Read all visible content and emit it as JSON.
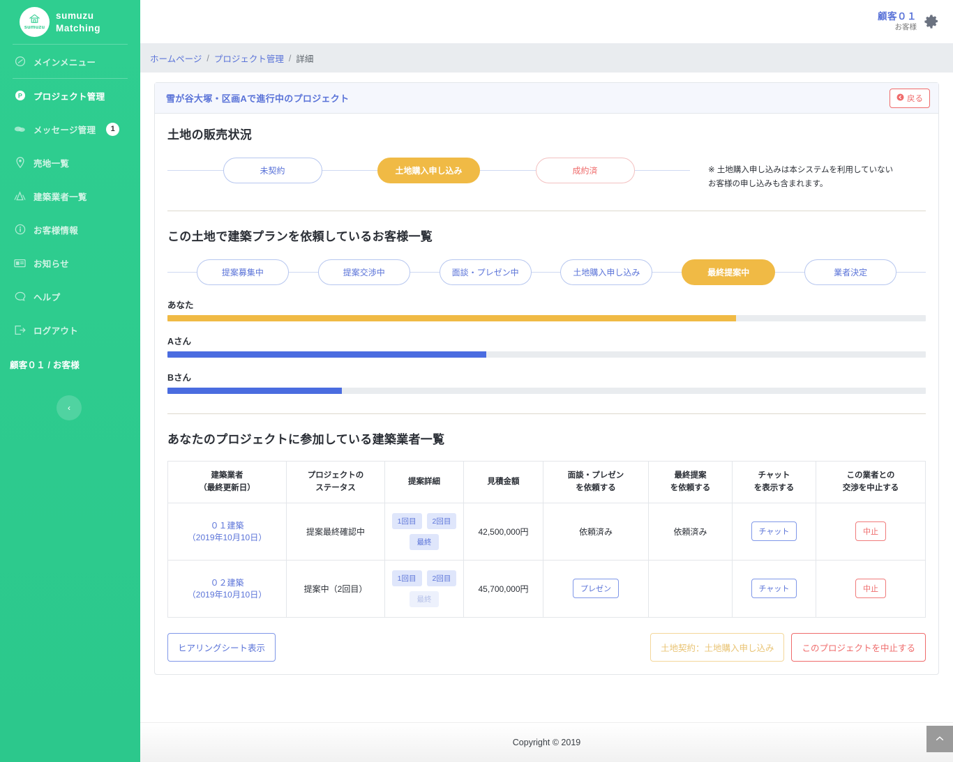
{
  "brand": {
    "logo_text": "sumuzu",
    "line1": "sumuzu",
    "line2": "Matching"
  },
  "sidebar": {
    "items": [
      {
        "label": "メインメニュー",
        "icon": "dashboard-icon"
      },
      {
        "label": "プロジェクト管理",
        "icon": "project-icon"
      },
      {
        "label": "メッセージ管理",
        "icon": "message-icon",
        "badge": "1"
      },
      {
        "label": "売地一覧",
        "icon": "map-pin-icon"
      },
      {
        "label": "建築業者一覧",
        "icon": "builders-icon"
      },
      {
        "label": "お客様情報",
        "icon": "info-icon"
      },
      {
        "label": "お知らせ",
        "icon": "news-icon"
      },
      {
        "label": "ヘルプ",
        "icon": "help-icon"
      },
      {
        "label": "ログアウト",
        "icon": "logout-icon"
      }
    ],
    "user_line": "顧客０１ / お客様",
    "collapse_label": "‹"
  },
  "header": {
    "user_name": "顧客０１",
    "user_role": "お客様",
    "gear_icon": "gear-icon"
  },
  "breadcrumb": {
    "home": "ホームページ",
    "sep": "/",
    "section": "プロジェクト管理",
    "current": "詳細"
  },
  "card": {
    "title": "雪が谷大塚・区画Aで進行中のプロジェクト",
    "back_label": "戻る"
  },
  "land_status": {
    "heading": "土地の販売状況",
    "steps": [
      {
        "label": "未契約",
        "state": "outline-blue"
      },
      {
        "label": "土地購入申し込み",
        "state": "filled-amber"
      },
      {
        "label": "成約済",
        "state": "outline-red"
      }
    ],
    "note_line1": "※ 土地購入申し込みは本システムを利用していない",
    "note_line2": "お客様の申し込みも含まれます。"
  },
  "customer_list": {
    "heading": "この土地で建築プランを依頼しているお客様一覧",
    "steps": [
      {
        "label": "提案募集中",
        "state": "outline-blue"
      },
      {
        "label": "提案交渉中",
        "state": "outline-blue"
      },
      {
        "label": "面談・プレゼン中",
        "state": "outline-blue"
      },
      {
        "label": "土地購入申し込み",
        "state": "outline-blue"
      },
      {
        "label": "最終提案中",
        "state": "filled-amber"
      },
      {
        "label": "業者決定",
        "state": "outline-blue"
      }
    ],
    "progress": [
      {
        "label": "あなた",
        "percent": 75,
        "color": "amber"
      },
      {
        "label": "Aさん",
        "percent": 42,
        "color": "blue"
      },
      {
        "label": "Bさん",
        "percent": 23,
        "color": "blue"
      }
    ]
  },
  "builders_table": {
    "heading": "あなたのプロジェクトに参加している建築業者一覧",
    "headers": [
      {
        "line1": "建築業者",
        "line2": "（最終更新日）"
      },
      {
        "line1": "プロジェクトの",
        "line2": "ステータス"
      },
      {
        "line1": "提案詳細",
        "line2": ""
      },
      {
        "line1": "見積金額",
        "line2": ""
      },
      {
        "line1": "面談・プレゼン",
        "line2": "を依頼する"
      },
      {
        "line1": "最終提案",
        "line2": "を依頼する"
      },
      {
        "line1": "チャット",
        "line2": "を表示する"
      },
      {
        "line1": "この業者との",
        "line2": "交渉を中止する"
      }
    ],
    "rows": [
      {
        "builder_name": "０１建築",
        "builder_date": "（2019年10月10日）",
        "status": "提案最終確認中",
        "proposals": [
          {
            "label": "1回目",
            "disabled": false
          },
          {
            "label": "2回目",
            "disabled": false
          },
          {
            "label": "最終",
            "disabled": false
          }
        ],
        "estimate": "42,500,000円",
        "presentation": {
          "type": "text",
          "label": "依頼済み"
        },
        "final_proposal": {
          "type": "text",
          "label": "依頼済み"
        },
        "chat": {
          "type": "button",
          "label": "チャット"
        },
        "cancel": {
          "type": "button",
          "label": "中止"
        }
      },
      {
        "builder_name": "０２建築",
        "builder_date": "（2019年10月10日）",
        "status": "提案中（2回目）",
        "proposals": [
          {
            "label": "1回目",
            "disabled": false
          },
          {
            "label": "2回目",
            "disabled": false
          },
          {
            "label": "最終",
            "disabled": true
          }
        ],
        "estimate": "45,700,000円",
        "presentation": {
          "type": "button",
          "label": "プレゼン"
        },
        "final_proposal": {
          "type": "empty",
          "label": ""
        },
        "chat": {
          "type": "button",
          "label": "チャット"
        },
        "cancel": {
          "type": "button",
          "label": "中止"
        }
      }
    ]
  },
  "actions": {
    "hearing_sheet": "ヒアリングシート表示",
    "land_contract": "土地契約：土地購入申し込み",
    "cancel_project": "このプロジェクトを中止する"
  },
  "footer": {
    "copyright": "Copyright © 2019",
    "to_top_icon": "chevron-up-icon"
  },
  "colors": {
    "brand_green": "#2ecc8f",
    "accent_blue": "#5a73d8",
    "accent_amber": "#f0ba45",
    "accent_red": "#ef6b6b",
    "progress_blue": "#4a6ce0",
    "track_gray": "#e9ecef"
  }
}
